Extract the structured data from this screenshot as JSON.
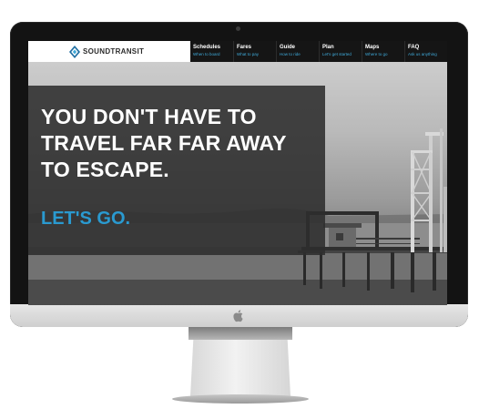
{
  "site": {
    "brand_name": "SOUNDTRANSIT"
  },
  "nav": {
    "items": [
      {
        "title": "Schedules",
        "subtitle": "When to board"
      },
      {
        "title": "Fares",
        "subtitle": "What to pay"
      },
      {
        "title": "Guide",
        "subtitle": "How to ride"
      },
      {
        "title": "Plan",
        "subtitle": "Let's get started"
      },
      {
        "title": "Maps",
        "subtitle": "Where to go"
      },
      {
        "title": "FAQ",
        "subtitle": "Ask us anything"
      }
    ]
  },
  "hero": {
    "headline_lines": [
      "YOU DON'T HAVE TO",
      "TRAVEL FAR FAR AWAY",
      "TO ESCAPE."
    ],
    "cta": "LET'S GO."
  },
  "colors": {
    "accent": "#2a9ad0",
    "nav_background": "#151515",
    "panel": "#2d2d2d"
  },
  "icons": {
    "brand": "diamond-logo-icon",
    "hardware": "apple-logo-icon"
  }
}
